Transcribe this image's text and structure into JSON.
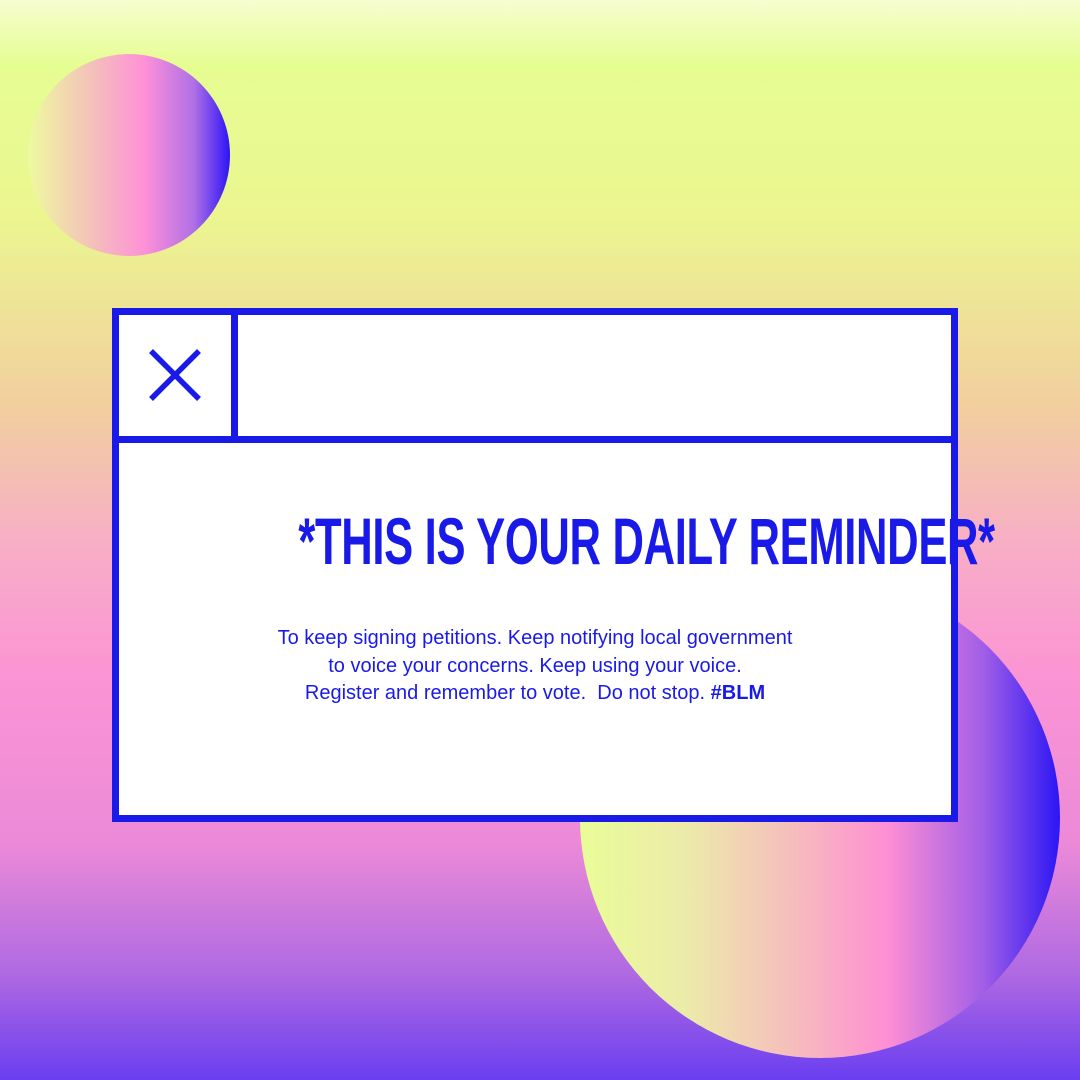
{
  "colors": {
    "accent": "#1a1ae8",
    "window_background": "#ffffff"
  },
  "window": {
    "close_icon": "close-icon",
    "headline": "*THIS IS YOUR DAILY REMINDER*",
    "body_lines": [
      "To keep signing petitions. Keep notifying local government",
      "to voice your concerns. Keep using your voice.",
      "Register and remember to vote.  Do not stop."
    ],
    "hashtag": "#BLM"
  }
}
